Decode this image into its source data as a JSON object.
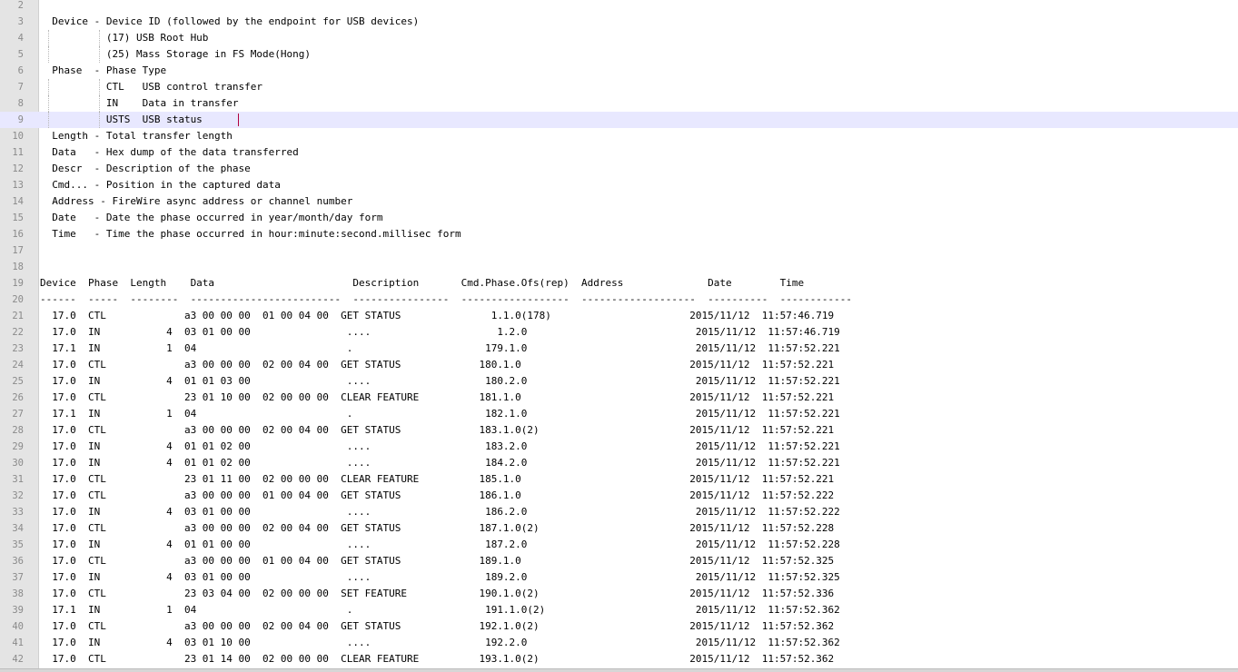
{
  "editor": {
    "caret_line_index": 7,
    "lines": [
      {
        "n": "2",
        "text": ""
      },
      {
        "n": "3",
        "text": "  Device - Device ID (followed by the endpoint for USB devices)"
      },
      {
        "n": "4",
        "text": "           (17) USB Root Hub",
        "guides": true
      },
      {
        "n": "5",
        "text": "           (25) Mass Storage in FS Mode(Hong)",
        "guides": true
      },
      {
        "n": "6",
        "text": "  Phase  - Phase Type"
      },
      {
        "n": "7",
        "text": "           CTL   USB control transfer",
        "guides": true
      },
      {
        "n": "8",
        "text": "           IN    Data in transfer",
        "guides": true
      },
      {
        "n": "9",
        "text": "           USTS  USB status",
        "guides": true
      },
      {
        "n": "10",
        "text": "  Length - Total transfer length"
      },
      {
        "n": "11",
        "text": "  Data   - Hex dump of the data transferred"
      },
      {
        "n": "12",
        "text": "  Descr  - Description of the phase"
      },
      {
        "n": "13",
        "text": "  Cmd... - Position in the captured data"
      },
      {
        "n": "14",
        "text": "  Address - FireWire async address or channel number"
      },
      {
        "n": "15",
        "text": "  Date   - Date the phase occurred in year/month/day form"
      },
      {
        "n": "16",
        "text": "  Time   - Time the phase occurred in hour:minute:second.millisec form"
      },
      {
        "n": "17",
        "text": ""
      },
      {
        "n": "18",
        "text": ""
      },
      {
        "n": "19",
        "text": "Device  Phase  Length    Data                       Description       Cmd.Phase.Ofs(rep)  Address              Date        Time"
      },
      {
        "n": "20",
        "text": "------  -----  --------  -------------------------  ----------------  ------------------  -------------------  ----------  ------------"
      },
      {
        "n": "21",
        "text": "  17.0  CTL             a3 00 00 00  01 00 04 00  GET STATUS               1.1.0(178)                       2015/11/12  11:57:46.719"
      },
      {
        "n": "22",
        "text": "  17.0  IN           4  03 01 00 00                ....                     1.2.0                            2015/11/12  11:57:46.719"
      },
      {
        "n": "23",
        "text": "  17.1  IN           1  04                         .                      179.1.0                            2015/11/12  11:57:52.221"
      },
      {
        "n": "24",
        "text": "  17.0  CTL             a3 00 00 00  02 00 04 00  GET STATUS             180.1.0                            2015/11/12  11:57:52.221"
      },
      {
        "n": "25",
        "text": "  17.0  IN           4  01 01 03 00                ....                   180.2.0                            2015/11/12  11:57:52.221"
      },
      {
        "n": "26",
        "text": "  17.0  CTL             23 01 10 00  02 00 00 00  CLEAR FEATURE          181.1.0                            2015/11/12  11:57:52.221"
      },
      {
        "n": "27",
        "text": "  17.1  IN           1  04                         .                      182.1.0                            2015/11/12  11:57:52.221"
      },
      {
        "n": "28",
        "text": "  17.0  CTL             a3 00 00 00  02 00 04 00  GET STATUS             183.1.0(2)                         2015/11/12  11:57:52.221"
      },
      {
        "n": "29",
        "text": "  17.0  IN           4  01 01 02 00                ....                   183.2.0                            2015/11/12  11:57:52.221"
      },
      {
        "n": "30",
        "text": "  17.0  IN           4  01 01 02 00                ....                   184.2.0                            2015/11/12  11:57:52.221"
      },
      {
        "n": "31",
        "text": "  17.0  CTL             23 01 11 00  02 00 00 00  CLEAR FEATURE          185.1.0                            2015/11/12  11:57:52.221"
      },
      {
        "n": "32",
        "text": "  17.0  CTL             a3 00 00 00  01 00 04 00  GET STATUS             186.1.0                            2015/11/12  11:57:52.222"
      },
      {
        "n": "33",
        "text": "  17.0  IN           4  03 01 00 00                ....                   186.2.0                            2015/11/12  11:57:52.222"
      },
      {
        "n": "34",
        "text": "  17.0  CTL             a3 00 00 00  02 00 04 00  GET STATUS             187.1.0(2)                         2015/11/12  11:57:52.228"
      },
      {
        "n": "35",
        "text": "  17.0  IN           4  01 01 00 00                ....                   187.2.0                            2015/11/12  11:57:52.228"
      },
      {
        "n": "36",
        "text": "  17.0  CTL             a3 00 00 00  01 00 04 00  GET STATUS             189.1.0                            2015/11/12  11:57:52.325"
      },
      {
        "n": "37",
        "text": "  17.0  IN           4  03 01 00 00                ....                   189.2.0                            2015/11/12  11:57:52.325"
      },
      {
        "n": "38",
        "text": "  17.0  CTL             23 03 04 00  02 00 00 00  SET FEATURE            190.1.0(2)                         2015/11/12  11:57:52.336"
      },
      {
        "n": "39",
        "text": "  17.1  IN           1  04                         .                      191.1.0(2)                         2015/11/12  11:57:52.362"
      },
      {
        "n": "40",
        "text": "  17.0  CTL             a3 00 00 00  02 00 04 00  GET STATUS             192.1.0(2)                         2015/11/12  11:57:52.362"
      },
      {
        "n": "41",
        "text": "  17.0  IN           4  03 01 10 00                ....                   192.2.0                            2015/11/12  11:57:52.362"
      },
      {
        "n": "42",
        "text": "  17.0  CTL             23 01 14 00  02 00 00 00  CLEAR FEATURE          193.1.0(2)                         2015/11/12  11:57:52.362"
      }
    ]
  }
}
